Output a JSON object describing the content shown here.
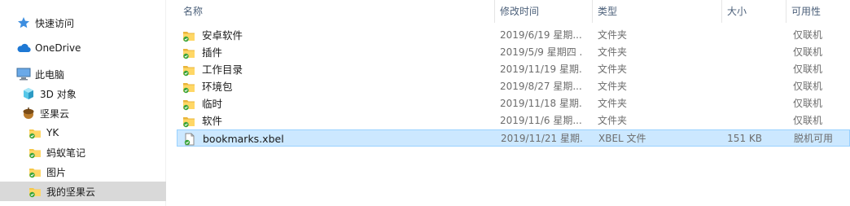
{
  "nav": {
    "items": [
      {
        "label": "快速访问",
        "icon": "star-icon"
      },
      {
        "label": "OneDrive",
        "icon": "cloud-icon"
      },
      {
        "label": "此电脑",
        "icon": "computer-icon"
      },
      {
        "label": "3D 对象",
        "icon": "cube-icon"
      },
      {
        "label": "坚果云",
        "icon": "nut-icon"
      },
      {
        "label": "YK",
        "icon": "synced-folder-icon"
      },
      {
        "label": "蚂蚁笔记",
        "icon": "synced-folder-icon"
      },
      {
        "label": "图片",
        "icon": "synced-folder-icon"
      },
      {
        "label": "我的坚果云",
        "icon": "synced-folder-icon",
        "selected": true
      }
    ]
  },
  "columns": {
    "name": "名称",
    "modified": "修改时间",
    "type": "类型",
    "size": "大小",
    "availability": "可用性",
    "sort_indicator": "^"
  },
  "files": [
    {
      "name": "安卓软件",
      "modified": "2019/6/19 星期...",
      "type": "文件夹",
      "size": "",
      "availability": "仅联机",
      "icon": "synced-folder-icon"
    },
    {
      "name": "插件",
      "modified": "2019/5/9 星期四 ...",
      "type": "文件夹",
      "size": "",
      "availability": "仅联机",
      "icon": "synced-folder-icon"
    },
    {
      "name": "工作目录",
      "modified": "2019/11/19 星期...",
      "type": "文件夹",
      "size": "",
      "availability": "仅联机",
      "icon": "synced-folder-icon"
    },
    {
      "name": "环境包",
      "modified": "2019/8/27 星期...",
      "type": "文件夹",
      "size": "",
      "availability": "仅联机",
      "icon": "synced-folder-icon"
    },
    {
      "name": "临时",
      "modified": "2019/11/18 星期...",
      "type": "文件夹",
      "size": "",
      "availability": "仅联机",
      "icon": "synced-folder-icon"
    },
    {
      "name": "软件",
      "modified": "2019/11/6 星期...",
      "type": "文件夹",
      "size": "",
      "availability": "仅联机",
      "icon": "synced-folder-icon"
    },
    {
      "name": "bookmarks.xbel",
      "modified": "2019/11/21 星期...",
      "type": "XBEL 文件",
      "size": "151 KB",
      "availability": "脱机可用",
      "icon": "synced-file-icon",
      "selected": true
    }
  ],
  "colors": {
    "selection_bg": "#cce8ff",
    "selection_border": "#99d1ff",
    "nav_selected_bg": "#d9d9d9",
    "header_text": "#4c607a",
    "folder_yellow": "#f5c74a",
    "sync_green": "#3aa43a"
  }
}
